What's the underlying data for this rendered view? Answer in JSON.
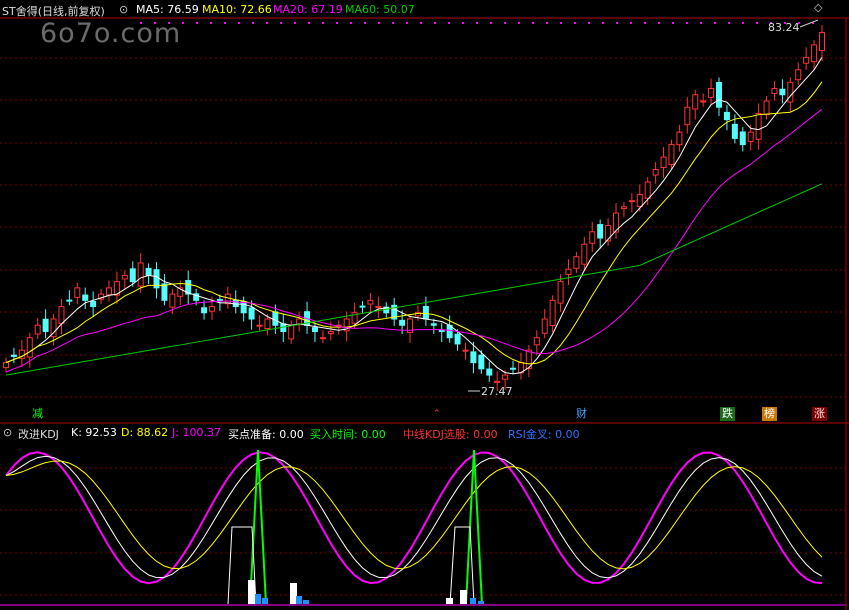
{
  "header": {
    "title": "ST舍得(日线,前复权)",
    "ma5": "MA5: 76.59",
    "ma10": "MA10: 72.66",
    "ma20": "MA20: 67.19",
    "ma60": "MA60: 50.07",
    "ma5_color": "#ffffff",
    "ma10_color": "#ffff00",
    "ma20_color": "#ff00ff",
    "ma60_color": "#00cc00"
  },
  "watermark": "6o7o.com",
  "price": {
    "high_label": "83.24",
    "low_label": "27.47"
  },
  "markers": {
    "jian": "减",
    "cai": "财",
    "die": "跌",
    "bang": "榜",
    "zhang": "涨"
  },
  "indicator": {
    "name": "改进KDJ",
    "k": "K: 92.53",
    "d": "D: 88.62",
    "j": "J: 100.37",
    "buy_prep": "买点准备: 0.00",
    "buy_time": "买入时间: 0.00",
    "mid_kdj": "中线KDJ选股: 0.00",
    "rsi": "RSI金叉: 0.00",
    "k_color": "#ffffff",
    "d_color": "#ffff00",
    "j_color": "#ff00ff"
  },
  "controls": {
    "collapse_icon": "circle-chevron-down-icon",
    "diamond_icon": "diamond-icon",
    "up_icon": "triangle-up-icon"
  },
  "colors": {
    "up": "#ff3232",
    "down": "#54fcfc",
    "grid": "#7a0000",
    "background": "#000000"
  }
}
